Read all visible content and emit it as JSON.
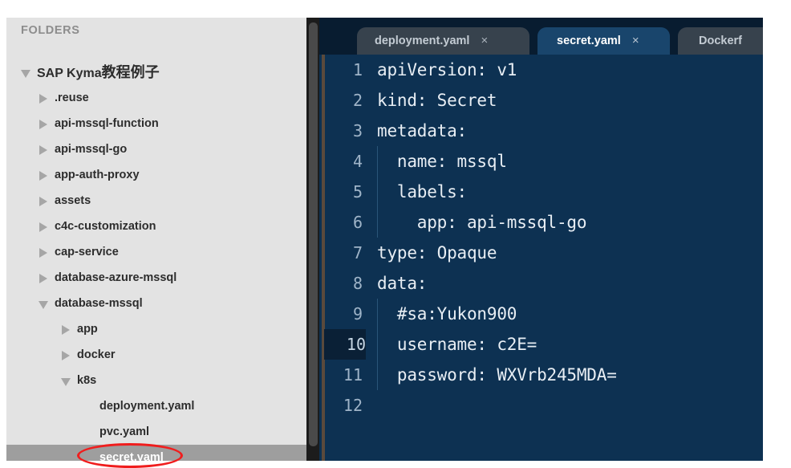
{
  "sidebar": {
    "header": "FOLDERS",
    "tree": [
      {
        "label": "SAP Kyma教程例子",
        "depth": 0,
        "state": "expanded",
        "root": true,
        "selected": false
      },
      {
        "label": ".reuse",
        "depth": 1,
        "state": "collapsed",
        "root": false,
        "selected": false
      },
      {
        "label": "api-mssql-function",
        "depth": 1,
        "state": "collapsed",
        "root": false,
        "selected": false
      },
      {
        "label": "api-mssql-go",
        "depth": 1,
        "state": "collapsed",
        "root": false,
        "selected": false
      },
      {
        "label": "app-auth-proxy",
        "depth": 1,
        "state": "collapsed",
        "root": false,
        "selected": false
      },
      {
        "label": "assets",
        "depth": 1,
        "state": "collapsed",
        "root": false,
        "selected": false
      },
      {
        "label": "c4c-customization",
        "depth": 1,
        "state": "collapsed",
        "root": false,
        "selected": false
      },
      {
        "label": "cap-service",
        "depth": 1,
        "state": "collapsed",
        "root": false,
        "selected": false
      },
      {
        "label": "database-azure-mssql",
        "depth": 1,
        "state": "collapsed",
        "root": false,
        "selected": false
      },
      {
        "label": "database-mssql",
        "depth": 1,
        "state": "expanded",
        "root": false,
        "selected": false
      },
      {
        "label": "app",
        "depth": 2,
        "state": "collapsed",
        "root": false,
        "selected": false
      },
      {
        "label": "docker",
        "depth": 2,
        "state": "collapsed",
        "root": false,
        "selected": false
      },
      {
        "label": "k8s",
        "depth": 2,
        "state": "expanded",
        "root": false,
        "selected": false
      },
      {
        "label": "deployment.yaml",
        "depth": 3,
        "state": "none",
        "root": false,
        "selected": false
      },
      {
        "label": "pvc.yaml",
        "depth": 3,
        "state": "none",
        "root": false,
        "selected": false
      },
      {
        "label": "secret.yaml",
        "depth": 3,
        "state": "none",
        "root": false,
        "selected": true
      }
    ],
    "annotation_color": "#f01d1d"
  },
  "editor": {
    "tabs": [
      {
        "label": "deployment.yaml",
        "close": "×",
        "active": false
      },
      {
        "label": "secret.yaml",
        "close": "×",
        "active": true
      },
      {
        "label": "Dockerf",
        "close": "",
        "active": false
      }
    ],
    "active_tab": "secret.yaml",
    "current_line": 10,
    "background_color": "#0d3152",
    "lines": [
      {
        "n": "1",
        "text": "apiVersion: v1",
        "indent_guide": false
      },
      {
        "n": "2",
        "text": "kind: Secret",
        "indent_guide": false
      },
      {
        "n": "3",
        "text": "metadata:",
        "indent_guide": false
      },
      {
        "n": "4",
        "text": "  name: mssql",
        "indent_guide": true
      },
      {
        "n": "5",
        "text": "  labels:",
        "indent_guide": true
      },
      {
        "n": "6",
        "text": "    app: api-mssql-go",
        "indent_guide": true
      },
      {
        "n": "7",
        "text": "type: Opaque",
        "indent_guide": false
      },
      {
        "n": "8",
        "text": "data:",
        "indent_guide": false
      },
      {
        "n": "9",
        "text": "  #sa:Yukon900",
        "indent_guide": true
      },
      {
        "n": "10",
        "text": "  username: c2E=",
        "indent_guide": true
      },
      {
        "n": "11",
        "text": "  password: WXVrb245MDA=",
        "indent_guide": true
      },
      {
        "n": "12",
        "text": "",
        "indent_guide": false
      }
    ]
  }
}
